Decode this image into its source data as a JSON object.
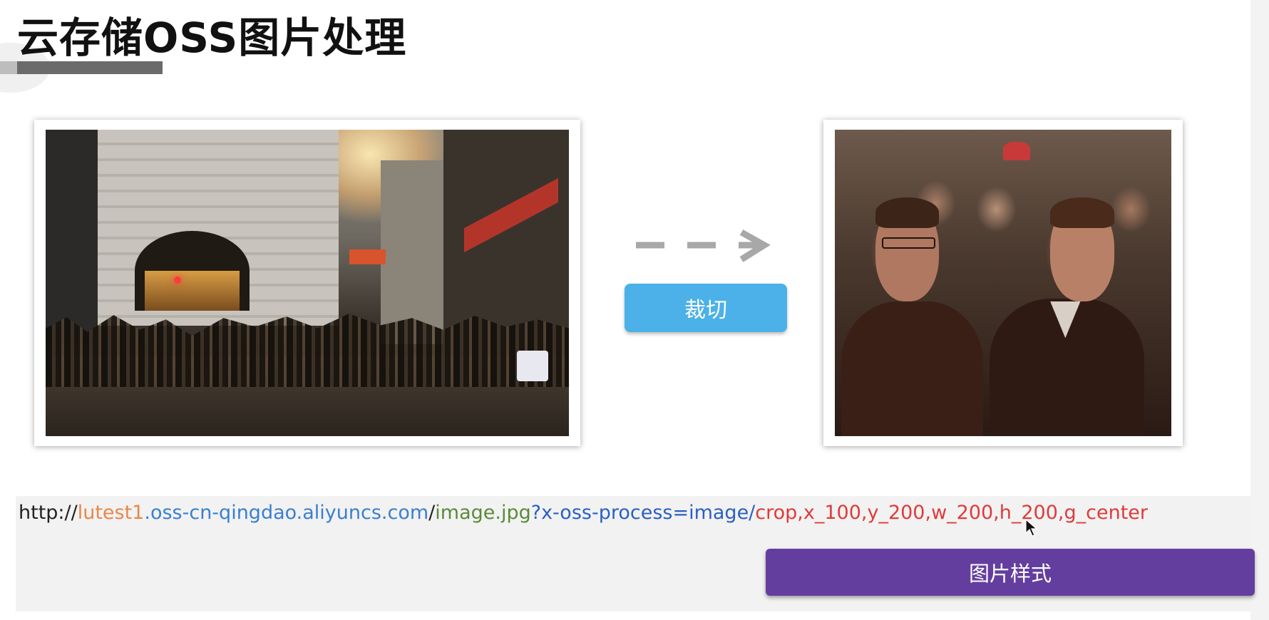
{
  "header": {
    "title": "云存储OSS图片处理"
  },
  "crop_button": {
    "label": "裁切"
  },
  "url": {
    "parts": [
      {
        "text": "http://",
        "color": "#222222"
      },
      {
        "text": "lutest1",
        "color": "#e8874a"
      },
      {
        "text": ".oss-cn-qingdao.aliyuncs.com",
        "color": "#3a7fd0"
      },
      {
        "text": "/",
        "color": "#222222"
      },
      {
        "text": "image.jpg",
        "color": "#5b8a3a"
      },
      {
        "text": "?x-oss-process=image/",
        "color": "#2a5fc4"
      },
      {
        "text": "crop,x_100,y_200,w_200,h_200,g_center",
        "color": "#e03a3a"
      }
    ]
  },
  "style_button": {
    "label": "图片样式"
  },
  "colors": {
    "crop_button_bg": "#4bb1e8",
    "style_button_bg": "#643e9f",
    "arrow": "#a8a8a8"
  }
}
